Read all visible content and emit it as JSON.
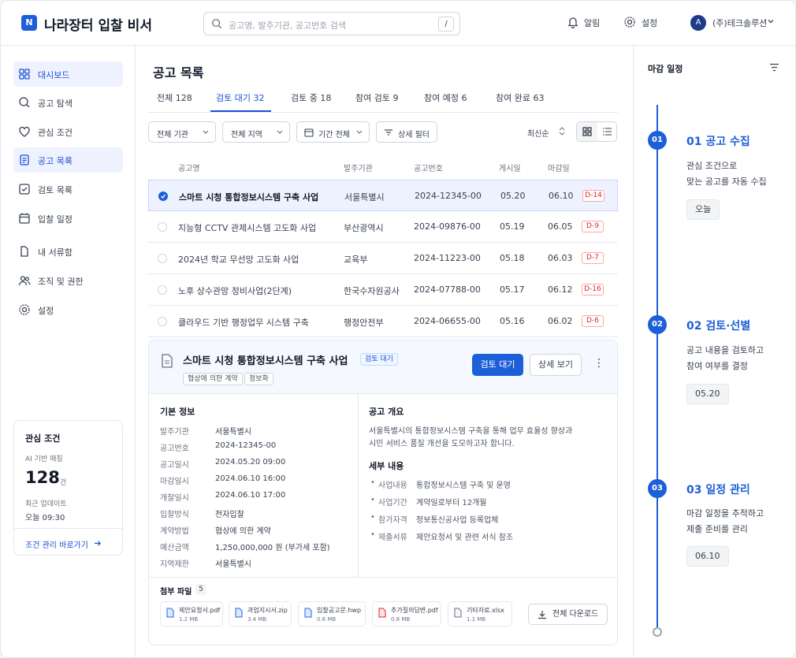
{
  "app": {
    "title": "나라장터 입찰 비서",
    "logo_mark": "N",
    "accent": "#1d5fd8"
  },
  "search": {
    "placeholder": "공고명, 발주기관, 공고번호 검색",
    "shortcut": "/"
  },
  "topbar": {
    "notifications": "알림",
    "settings": "설정",
    "avatar_initial": "A",
    "user": "(주)테크솔루션"
  },
  "sidebar": {
    "items": [
      {
        "label": "대시보드",
        "icon": "grid-icon"
      },
      {
        "label": "공고 탐색",
        "icon": "search-doc-icon"
      },
      {
        "label": "관심 조건",
        "icon": "heart-icon"
      },
      {
        "label": "공고 목록",
        "icon": "document-icon"
      },
      {
        "label": "검토 목록",
        "icon": "check-square-icon"
      },
      {
        "label": "입찰 일정",
        "icon": "calendar-icon"
      },
      {
        "label": "내 서류함",
        "icon": "file-icon"
      },
      {
        "label": "조직 및 권한",
        "icon": "users-icon"
      },
      {
        "label": "설정",
        "icon": "gear-icon"
      }
    ],
    "card": {
      "title": "관심 조건",
      "subtitle": "AI 기반 매칭",
      "count": "128",
      "unit": "건",
      "updated_label": "최근 업데이트",
      "updated_value": "오늘 09:30",
      "link": "조건 관리 바로가기"
    }
  },
  "main": {
    "title": "공고 목록",
    "tabs": [
      {
        "label": "전체",
        "count": "128"
      },
      {
        "label": "검토 대기",
        "count": "32"
      },
      {
        "label": "검토 중",
        "count": "18"
      },
      {
        "label": "참여 검토",
        "count": "9"
      },
      {
        "label": "참여 예정",
        "count": "6"
      },
      {
        "label": "참여 완료",
        "count": "63"
      }
    ],
    "filters": {
      "agency": "전체 기관",
      "region": "전체 지역",
      "period": "기간 전체",
      "detail": "상세 필터",
      "sort": "최신순"
    },
    "columns": [
      "공고명",
      "발주기관",
      "공고번호",
      "게시일",
      "마감일"
    ],
    "rows": [
      {
        "name": "스마트 시청 통합정보시스템 구축 사업",
        "agency": "서울특별시",
        "number": "2024-12345-00",
        "posted": "05.20",
        "deadline": "06.10",
        "dday": "D-14"
      },
      {
        "name": "지능형 CCTV 관제시스템 고도화 사업",
        "agency": "부산광역시",
        "number": "2024-09876-00",
        "posted": "05.19",
        "deadline": "06.05",
        "dday": "D-9"
      },
      {
        "name": "2024년 학교 무선망 고도화 사업",
        "agency": "교육부",
        "number": "2024-11223-00",
        "posted": "05.18",
        "deadline": "06.03",
        "dday": "D-7"
      },
      {
        "name": "노후 상수관망 정비사업(2단계)",
        "agency": "한국수자원공사",
        "number": "2024-07788-00",
        "posted": "05.17",
        "deadline": "06.12",
        "dday": "D-16"
      },
      {
        "name": "클라우드 기반 행정업무 시스템 구축",
        "agency": "행정안전부",
        "number": "2024-06655-00",
        "posted": "05.16",
        "deadline": "06.02",
        "dday": "D-6"
      }
    ]
  },
  "detail": {
    "title": "스마트 시청 통합정보시스템 구축 사업",
    "status": "검토 대기",
    "tags": [
      "협상에 의한 계약",
      "정보화"
    ],
    "primary_btn": "검토 대기",
    "secondary_btn": "상세 보기",
    "more": "⋮",
    "basic_title": "기본 정보",
    "basic": [
      {
        "k": "발주기관",
        "v": "서울특별시"
      },
      {
        "k": "공고번호",
        "v": "2024-12345-00"
      },
      {
        "k": "공고일시",
        "v": "2024.05.20 09:00"
      },
      {
        "k": "마감일시",
        "v": "2024.06.10 16:00"
      },
      {
        "k": "개찰일시",
        "v": "2024.06.10 17:00"
      },
      {
        "k": "입찰방식",
        "v": "전자입찰"
      },
      {
        "k": "계약방법",
        "v": "협상에 의한 계약"
      },
      {
        "k": "예산금액",
        "v": "1,250,000,000 원 (부가세 포함)"
      },
      {
        "k": "지역제한",
        "v": "서울특별시"
      }
    ],
    "overview_title": "공고 개요",
    "overview": [
      "서울특별시의 통합정보시스템 구축을 통해 업무 효율성 향상과",
      "시민 서비스 품질 개선을 도모하고자 합니다."
    ],
    "details_title": "세부 내용",
    "details": [
      {
        "k": "사업내용",
        "v": "통합정보시스템 구축 및 운영"
      },
      {
        "k": "사업기간",
        "v": "계약일로부터 12개월"
      },
      {
        "k": "참가자격",
        "v": "정보통신공사업 등록업체"
      },
      {
        "k": "제출서류",
        "v": "제안요청서 및 관련 서식 참조"
      }
    ],
    "attach_title": "첨부 파일",
    "attach_count": "5",
    "files": [
      {
        "name": "제안요청서.pdf",
        "size": "1.2 MB",
        "color": "#2563eb"
      },
      {
        "name": "과업지시서.zip",
        "size": "3.4 MB",
        "color": "#2563eb"
      },
      {
        "name": "입찰공고문.hwp",
        "size": "0.6 MB",
        "color": "#2563eb"
      },
      {
        "name": "추가질의답변.pdf",
        "size": "0.8 MB",
        "color": "#dc2626"
      },
      {
        "name": "기타자료.xlsx",
        "size": "1.1 MB",
        "color": "#6b7280"
      }
    ],
    "download_all": "전체 다운로드"
  },
  "schedule": {
    "title": "마감 일정",
    "steps": [
      {
        "num": "01",
        "title": "01 공고 수집",
        "desc": [
          "관심 조건으로",
          "맞는 공고를 자동 수집"
        ],
        "badge": "오늘"
      },
      {
        "num": "02",
        "title": "02 검토·선별",
        "desc": [
          "공고 내용을 검토하고",
          "참여 여부를 결정"
        ],
        "badge": "05.20"
      },
      {
        "num": "03",
        "title": "03 일정 관리",
        "desc": [
          "마감 일정을 추적하고",
          "제출 준비를 관리"
        ],
        "badge": "06.10"
      }
    ]
  }
}
